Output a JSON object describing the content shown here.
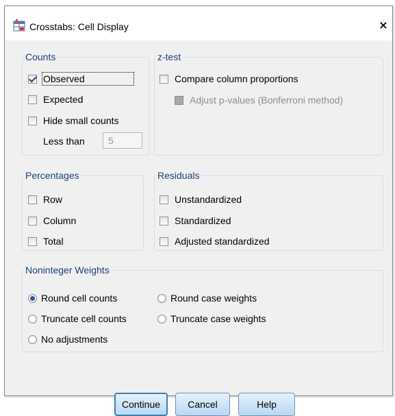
{
  "window": {
    "title": "Crosstabs: Cell Display",
    "close_glyph": "×"
  },
  "counts": {
    "legend": "Counts",
    "observed": {
      "label": "Observed",
      "checked": true
    },
    "expected": {
      "label": "Expected",
      "checked": false
    },
    "hide_small": {
      "label": "Hide small counts",
      "checked": false
    },
    "less_than_label": "Less than",
    "less_than_value": "5"
  },
  "ztest": {
    "legend": "z-test",
    "compare": {
      "label": "Compare column proportions",
      "checked": false
    },
    "adjust": {
      "label": "Adjust p-values (Bonferroni method)",
      "enabled": false
    }
  },
  "percentages": {
    "legend": "Percentages",
    "row": "Row",
    "column": "Column",
    "total": "Total"
  },
  "residuals": {
    "legend": "Residuals",
    "unstandardized": "Unstandardized",
    "standardized": "Standardized",
    "adjusted": "Adjusted standardized"
  },
  "weights": {
    "legend": "Noninteger Weights",
    "round_cell": "Round cell counts",
    "truncate_cell": "Truncate cell counts",
    "no_adjust": "No adjustments",
    "round_case": "Round case weights",
    "truncate_case": "Truncate case weights",
    "selected": "Round cell counts"
  },
  "buttons": {
    "continue": "Continue",
    "cancel": "Cancel",
    "help": "Help"
  },
  "colors": {
    "legend_text": "#1d3f7a",
    "button_border": "#3c7fb1",
    "dialog_bg": "#f0f0f0"
  }
}
